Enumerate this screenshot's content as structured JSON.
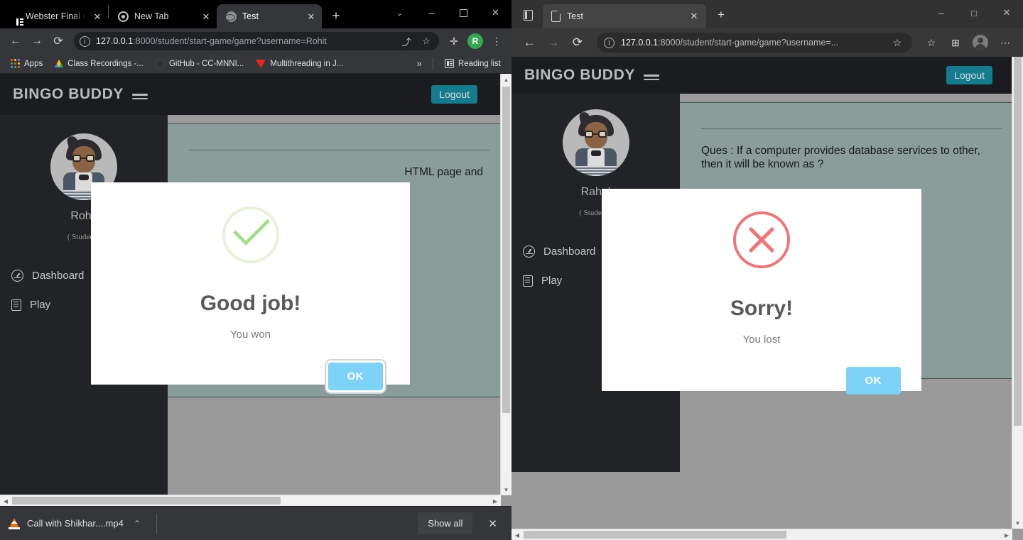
{
  "chrome_window": {
    "tabs": [
      {
        "title": "Webster Final Cod",
        "favicon": "doc-icon",
        "active": false
      },
      {
        "title": "New Tab",
        "favicon": "chrome-ring-icon",
        "active": false
      },
      {
        "title": "Test",
        "favicon": "globe-icon",
        "active": true
      }
    ],
    "new_tab_label": "+",
    "window_controls": {
      "tab_search": "⌄",
      "minimize": "–",
      "maximize": "□",
      "close": "✕"
    },
    "toolbar": {
      "back": "←",
      "forward": "→",
      "reload": "⟳",
      "url_host": "127.0.0.1",
      "url_rest": ":8000/student/start-game/game?username=Rohit",
      "share": "⤴",
      "bookmark": "☆",
      "extensions": "✛",
      "profile_initial": "R",
      "menu": "⋮"
    },
    "bookmarks": {
      "apps_label": "Apps",
      "items": [
        {
          "label": "Class Recordings -...",
          "icon": "drive-icon"
        },
        {
          "label": "GitHub - CC-MNNI...",
          "icon": "github-icon"
        },
        {
          "label": "Multithreading in J...",
          "icon": "video-icon"
        }
      ],
      "overflow": "»",
      "reading_list": "Reading list"
    },
    "download_shelf": {
      "file_name": "Call with Shikhar....mp4",
      "file_icon": "vlc-icon",
      "caret": "⌃",
      "show_all": "Show all",
      "close": "✕"
    }
  },
  "edge_window": {
    "tab_search_icon": "tabs-icon",
    "tab": {
      "title": "Test",
      "favicon": "page-icon",
      "close": "✕"
    },
    "new_tab_label": "+",
    "window_controls": {
      "minimize": "–",
      "maximize": "□",
      "close": "✕"
    },
    "toolbar": {
      "back": "←",
      "forward": "→",
      "reload": "⟳",
      "url_host": "127.0.0.1",
      "url_rest": ":8000/student/start-game/game?username=...",
      "add_favorite": "☆",
      "favorites": "☆",
      "collections": "⊞",
      "profile": "avatar-icon",
      "settings": "⋯"
    }
  },
  "app_left": {
    "brand": "BINGO BUDDY",
    "menu_icon": "hamburger-icon",
    "logout_label": "Logout",
    "user_name": "Rohit",
    "user_role": "( Student )",
    "nav": [
      {
        "label": "Dashboard",
        "icon": "dashboard-icon"
      },
      {
        "label": "Play",
        "icon": "book-icon"
      }
    ],
    "question_text": "HTML page and",
    "modal": {
      "icon": "success-check-icon",
      "title": "Good job!",
      "text": "You won",
      "confirm_label": "OK",
      "confirm_color": "#7cd3f7",
      "icon_color": "#a5dc86"
    }
  },
  "app_right": {
    "brand": "BINGO BUDDY",
    "menu_icon": "hamburger-icon",
    "logout_label": "Logout",
    "user_name": "Rahul",
    "user_role": "( Student )",
    "nav": [
      {
        "label": "Dashboard",
        "icon": "dashboard-icon"
      },
      {
        "label": "Play",
        "icon": "book-icon"
      }
    ],
    "question_text": "Ques : If a computer provides database services to other, then it will be known as ?",
    "modal": {
      "icon": "error-x-icon",
      "title": "Sorry!",
      "text": "You lost",
      "confirm_label": "OK",
      "confirm_color": "#7cd3f7",
      "icon_color": "#f27474"
    }
  },
  "theme": {
    "header_bg": "#1b1c20",
    "sidebar_bg": "#212326",
    "quiz_bg": "#8b9d9a",
    "page_bg": "#9a9a9a",
    "logout_bg": "#157b8e"
  }
}
